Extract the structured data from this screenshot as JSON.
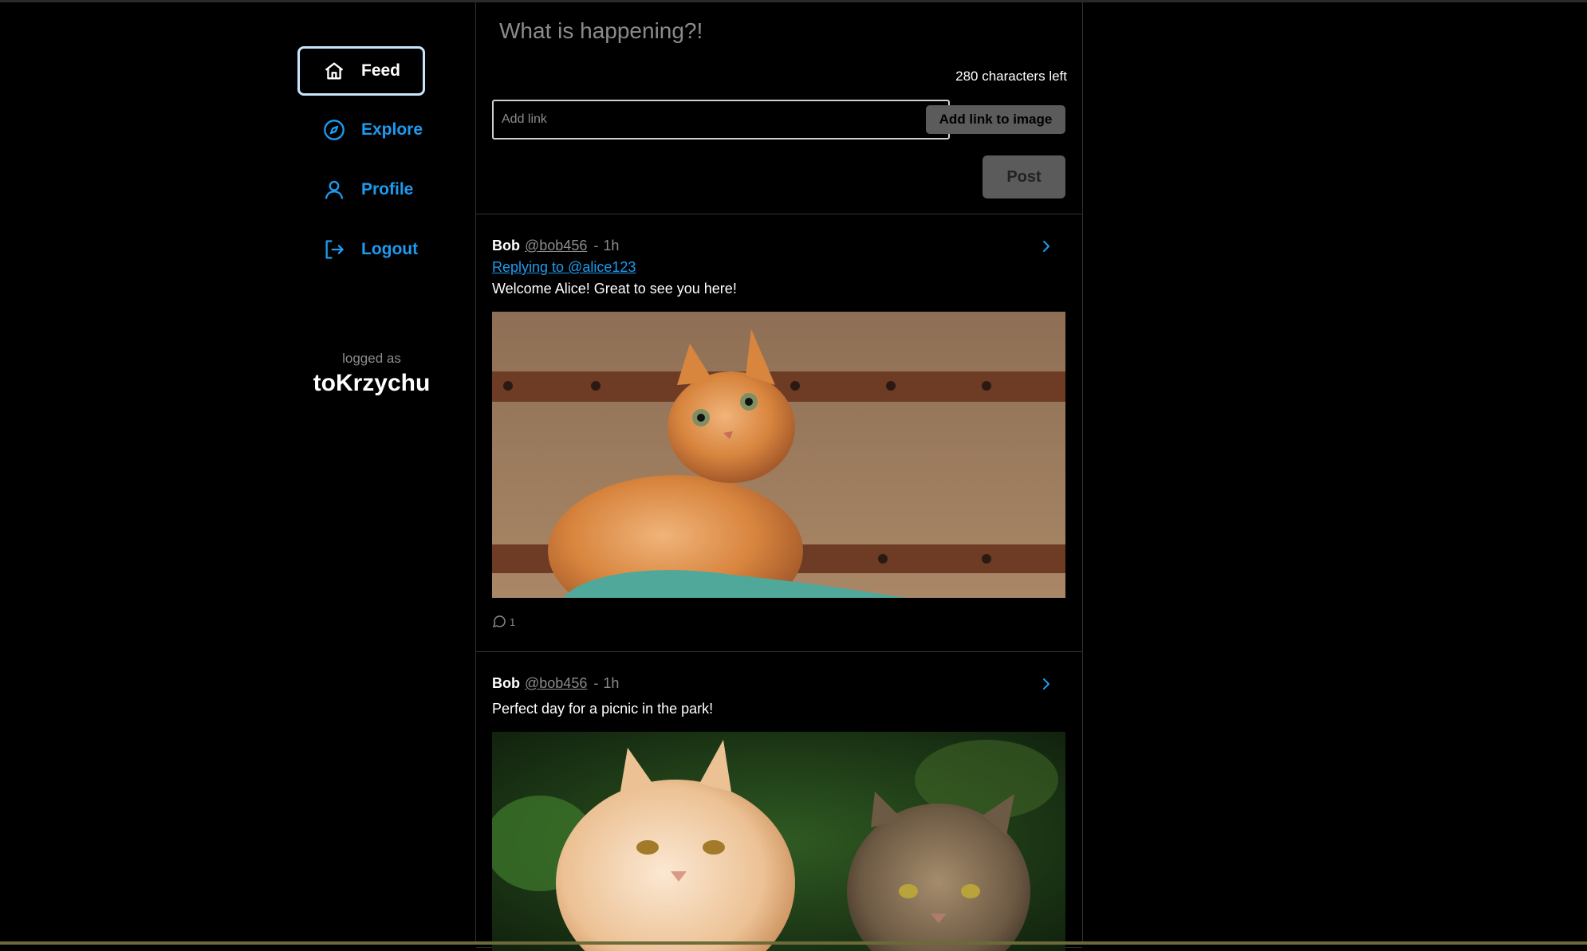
{
  "nav": {
    "items": [
      {
        "label": "Feed",
        "icon": "home-icon",
        "active": true
      },
      {
        "label": "Explore",
        "icon": "compass-icon",
        "active": false
      },
      {
        "label": "Profile",
        "icon": "user-icon",
        "active": false
      },
      {
        "label": "Logout",
        "icon": "logout-icon",
        "active": false
      }
    ]
  },
  "session": {
    "logged_label": "logged as",
    "username": "toKrzychu"
  },
  "composer": {
    "prompt": "What is happening?!",
    "counter": "280 characters left",
    "link_placeholder": "Add link",
    "add_link_label": "Add link to image",
    "post_label": "Post"
  },
  "posts": [
    {
      "name": "Bob",
      "handle": "@bob456",
      "sep": "-",
      "time": "1h",
      "reply_to": "Replying to @alice123",
      "text": "Welcome Alice! Great to see you here!",
      "comments": "1"
    },
    {
      "name": "Bob",
      "handle": "@bob456",
      "sep": "-",
      "time": "1h",
      "text": "Perfect day for a picnic in the park!"
    }
  ],
  "colors": {
    "accent": "#1d9bf0",
    "background": "#000000",
    "muted": "#8b8b8b",
    "button": "#5b5b5b"
  }
}
